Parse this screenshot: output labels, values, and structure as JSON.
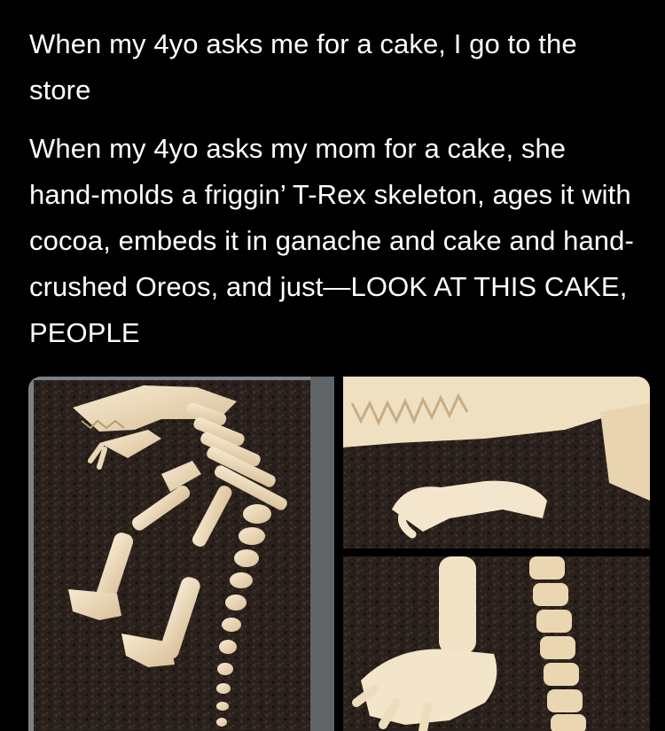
{
  "post": {
    "line_1": "When my 4yo asks me for a cake, I go to the store",
    "line_2": "When my 4yo asks my mom for a cake, she hand-molds a friggin’ T-Rex skeleton, ages it with cocoa, embeds it in ganache and cake and hand-crushed Oreos, and just—LOOK AT THIS CAKE, PEOPLE"
  },
  "colors": {
    "background": "#000000",
    "text": "#ffffff",
    "oreo_crumb": "#2a211c",
    "bone": "#f1e1c4",
    "pan": "#9a9ea3"
  },
  "photos": [
    {
      "subject": "full-tyrannosaurus-skeleton-cake-in-pan"
    },
    {
      "subject": "skull-and-claw-closeup"
    },
    {
      "subject": "foot-and-tail-closeup"
    }
  ]
}
